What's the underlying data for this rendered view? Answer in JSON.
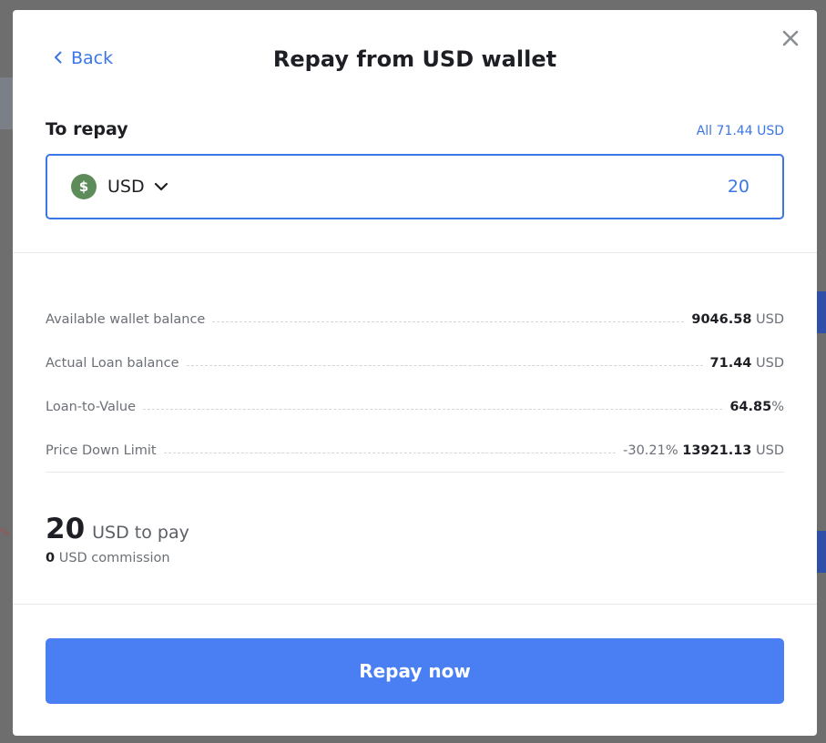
{
  "header": {
    "back_label": "Back",
    "title": "Repay from USD wallet"
  },
  "repay": {
    "label": "To repay",
    "all_prefix": "All",
    "all_amount": "71.44",
    "all_currency": "USD",
    "currency": "USD",
    "coin_symbol": "$",
    "amount_value": "20"
  },
  "details": [
    {
      "label": "Available wallet balance",
      "prefix": "",
      "value": "9046.58",
      "unit": "USD"
    },
    {
      "label": "Actual Loan balance",
      "prefix": "",
      "value": "71.44",
      "unit": "USD"
    },
    {
      "label": "Loan-to-Value",
      "prefix": "",
      "value": "64.85",
      "unit": "%"
    },
    {
      "label": "Price Down Limit",
      "prefix": "-30.21%",
      "value": "13921.13",
      "unit": "USD"
    }
  ],
  "summary": {
    "amount": "20",
    "to_pay_text": "USD to pay",
    "commission_value": "0",
    "commission_text": "USD commission"
  },
  "actions": {
    "repay_label": "Repay now"
  },
  "background": {
    "pct_fragment": "%"
  },
  "colors": {
    "accent": "#3b76e6",
    "button": "#4a7ff3",
    "coin": "#5d8c5a"
  },
  "icons": {
    "back": "chevron-left-icon",
    "close": "close-icon",
    "dropdown": "chevron-down-icon",
    "coin": "dollar-coin-icon"
  }
}
